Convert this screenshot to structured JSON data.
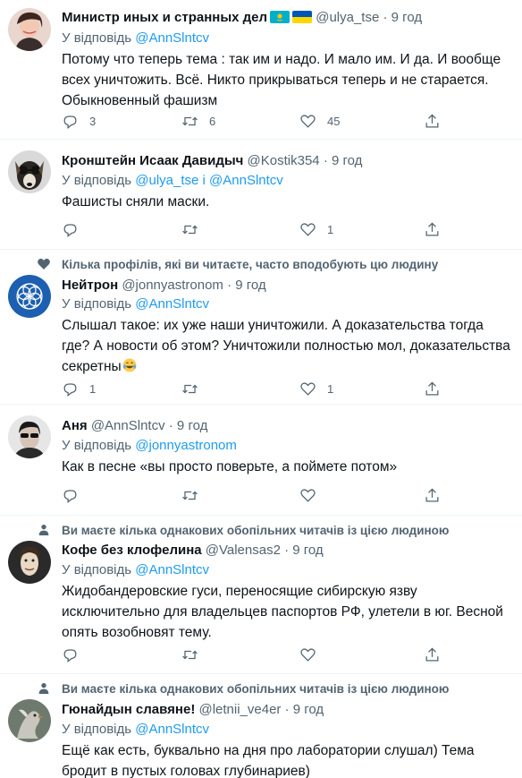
{
  "tweets": [
    {
      "name": "Министр иных и странных дел",
      "handle": "@ulya_tse",
      "time": "· 9 год",
      "reply_prefix": "У відповідь ",
      "reply_to": "@AnnSlntcv",
      "text": "Потому что теперь тема : так им и надо. И мало им. И да. И вообще всех уничтожить. Всё. Никто прикрываться теперь и не старается. Обыкновенный фашизм",
      "replies": "3",
      "retweets": "6",
      "likes": "45",
      "flags": [
        "kazakhstan-flag",
        "ukraine-flag"
      ]
    },
    {
      "name": "Кронштейн Исаак Давидыч",
      "handle": "@Kostik354",
      "time": "· 9 год",
      "reply_prefix": "У відповідь ",
      "reply_to": "@ulya_tse і @AnnSlntcv",
      "text": "Фашисты сняли маски.",
      "replies": "",
      "retweets": "",
      "likes": "1"
    },
    {
      "social": "Кілька профілів, які ви читаєте, часто вподобують цю людину",
      "social_icon": "heart-icon",
      "name": "Нейтрон",
      "handle": "@jonnyastronom",
      "time": "· 9 год",
      "reply_prefix": "У відповідь ",
      "reply_to": "@AnnSlntcv",
      "text": "Слышал такое: их уже наши уничтожили. А доказательства тогда где? А новости об этом? Уничтожили полностью мол, доказательства секретны",
      "emoji": "tears-of-joy-emoji",
      "replies": "1",
      "retweets": "",
      "likes": "1"
    },
    {
      "name": "Аня",
      "handle": "@AnnSlntcv",
      "time": "· 9 год",
      "reply_prefix": "У відповідь ",
      "reply_to": "@jonnyastronom",
      "text": "Как в песне «вы просто поверьте, а поймете потом»",
      "replies": "",
      "retweets": "",
      "likes": ""
    },
    {
      "social": "Ви маєте кілька однакових обопільних читачів із цією людиною",
      "social_icon": "person-icon",
      "name": "Кофе без клофелина",
      "handle": "@Valensas2",
      "time": "· 9 год",
      "reply_prefix": "У відповідь ",
      "reply_to": "@AnnSlntcv",
      "text": "Жидобандеровские гуси, переносящие сибирскую язву исключительно для владельцев паспортов РФ, улетели в юг. Весной опять возобновят тему.",
      "replies": "",
      "retweets": "",
      "likes": ""
    },
    {
      "social": "Ви маєте кілька однакових обопільних читачів із цією людиною",
      "social_icon": "person-icon",
      "name": "Гюнайдын славяне!",
      "handle": "@letnii_ve4er",
      "time": "· 9 год",
      "reply_prefix": "У відповідь ",
      "reply_to": "@AnnSlntcv",
      "text": "Ещё как есть, буквально на дня про лаборатории слушал) Тема бродит в пустых головах глубинариев)"
    }
  ]
}
